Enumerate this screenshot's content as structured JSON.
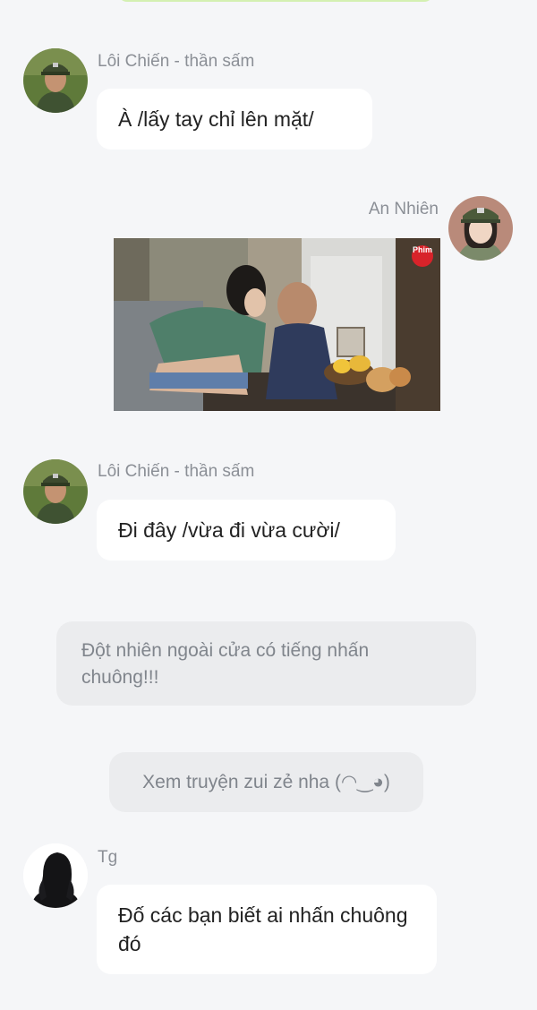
{
  "messages": [
    {
      "sender": "Lôi Chiến - thần sấm",
      "text": "À /lấy tay chỉ lên mặt/"
    },
    {
      "sender": "An Nhiên"
    },
    {
      "sender": "Lôi Chiến - thần sấm",
      "text": "Đi đây /vừa đi vừa cười/"
    },
    {
      "sender": "Tg",
      "text": "Đố các bạn biết ai nhấn chuông đó"
    }
  ],
  "narration": "Đột nhiên ngoài cửa có tiếng nhấn chuông!!!",
  "footer_note": "Xem truyện zui zẻ nha (◠‿◕)",
  "photo_watermark": "Phim",
  "colors": {
    "background": "#f5f6f8",
    "bubble": "#ffffff",
    "notice_bg": "#ebecee",
    "top_pill": "#d4f0b2",
    "sender_text": "#8b8f96"
  },
  "icons": {
    "avatar_1": "soldier-avatar-icon",
    "avatar_2": "girl-in-cap-avatar-icon",
    "avatar_3": "silhouette-avatar-icon"
  }
}
